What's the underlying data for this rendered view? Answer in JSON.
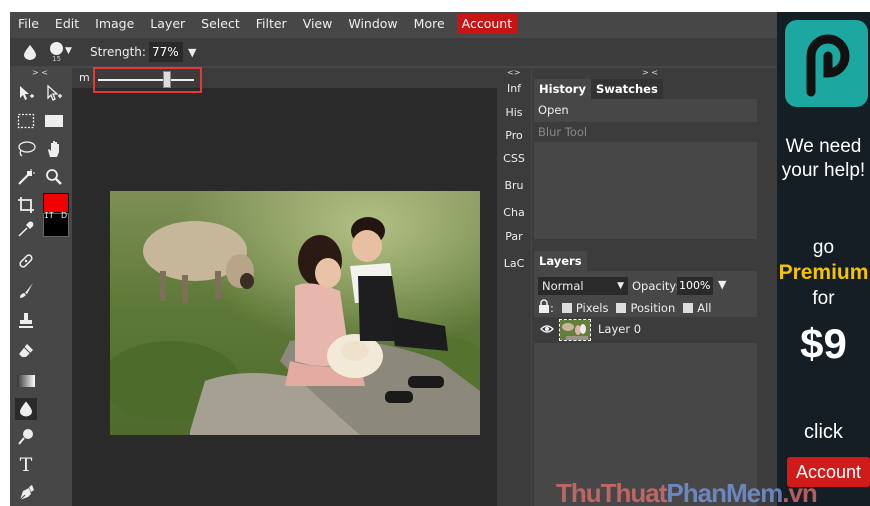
{
  "menu": {
    "items": [
      "File",
      "Edit",
      "Image",
      "Layer",
      "Select",
      "Filter",
      "View",
      "Window",
      "More"
    ],
    "account": "Account"
  },
  "options": {
    "brush_size": "15",
    "strength_label": "Strength:",
    "strength_value": "77%"
  },
  "toolbar": {
    "collapse": "> <",
    "swatch_label": "IT",
    "swatch_default": "D",
    "foreground_color": "#f00000",
    "background_color": "#000000",
    "tool_icons": [
      "move-icon",
      "select-icon",
      "marquee-icon",
      "rect-icon",
      "lasso-icon",
      "hand-icon",
      "wand-icon",
      "zoom-icon",
      "crop-icon",
      "eyedropper-icon",
      "heal-icon",
      "brush-icon",
      "stamp-icon",
      "eraser-icon",
      "gradient-icon",
      "blur-icon",
      "dodge-icon",
      "text-icon",
      "pen-icon"
    ]
  },
  "workspace": {
    "tab_label": "m",
    "slider_level": 0.72
  },
  "midpanel": {
    "collapse": "<>",
    "items": [
      "Inf",
      "His",
      "Pro",
      "CSS",
      "Bru",
      "Cha",
      "Par",
      "LaC"
    ]
  },
  "history": {
    "collapse": "> <",
    "tab_history": "History",
    "tab_swatches": "Swatches",
    "items": [
      "Open",
      "Blur Tool"
    ]
  },
  "layers": {
    "tab": "Layers",
    "blend_mode": "Normal",
    "opacity_label": "Opacity:",
    "opacity_value": "100%",
    "lock_colon": ":",
    "lock_pixels": "Pixels",
    "lock_position": "Position",
    "lock_all": "All",
    "layer_name": "Layer 0"
  },
  "ad": {
    "line1": "We need",
    "line2": "your help!",
    "go": "go",
    "premium": "Premium",
    "for": "for",
    "price": "$9",
    "click": "click",
    "button": "Account",
    "logo_color": "#1ca8a0"
  },
  "watermark": {
    "part1": "ThuThuat",
    "part2": "PhanMem",
    "part3": ".vn"
  }
}
